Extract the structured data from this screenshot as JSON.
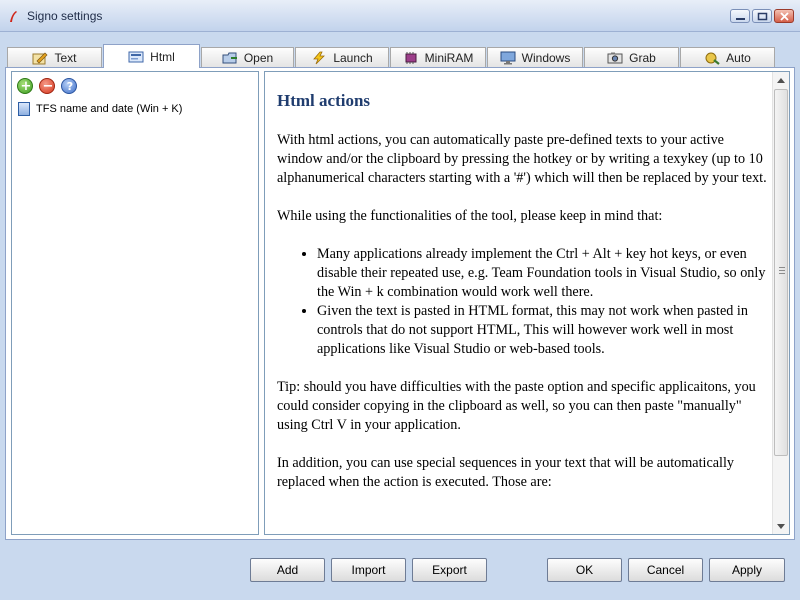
{
  "window": {
    "title": "Signo settings"
  },
  "tabs": [
    {
      "label": "Text",
      "icon": "pencil-icon"
    },
    {
      "label": "Html",
      "icon": "html-icon"
    },
    {
      "label": "Open",
      "icon": "open-icon"
    },
    {
      "label": "Launch",
      "icon": "lightning-icon"
    },
    {
      "label": "MiniRAM",
      "icon": "chip-icon"
    },
    {
      "label": "Windows",
      "icon": "monitor-icon"
    },
    {
      "label": "Grab",
      "icon": "camera-icon"
    },
    {
      "label": "Auto",
      "icon": "auto-icon"
    }
  ],
  "active_tab": "Html",
  "list": {
    "toolbar": {
      "add_symbol": "+",
      "remove_symbol": "−",
      "help_symbol": "?"
    },
    "items": [
      {
        "label": "TFS name and date (Win + K)"
      }
    ]
  },
  "content": {
    "heading": "Html actions",
    "para1": "With html actions, you can automatically paste pre-defined texts to your active window and/or the clipboard by pressing the hotkey or by writing a texykey (up to 10 alphanumerical characters starting with a '#') which will then be replaced by your text.",
    "para2": "While using the functionalities of the tool, please keep in mind that:",
    "bullet1": "Many applications already implement the Ctrl + Alt + key hot keys, or even disable their repeated use, e.g. Team Foundation tools in Visual Studio, so only the Win + k combination would work well there.",
    "bullet2": "Given the text is pasted in HTML format, this may not work when pasted in controls that do not support HTML, This will however work well in most applications like Visual Studio or web-based tools.",
    "para3": "Tip: should you have difficulties with the paste option and specific applicaitons, you could consider copying in the clipboard as well, so you can then paste \"manually\" using Ctrl V in your application.",
    "para4": "In addition, you can use special sequences in your text that will be automatically replaced when the action is executed. Those are:"
  },
  "buttons": {
    "add": "Add",
    "import": "Import",
    "export": "Export",
    "ok": "OK",
    "cancel": "Cancel",
    "apply": "Apply"
  }
}
